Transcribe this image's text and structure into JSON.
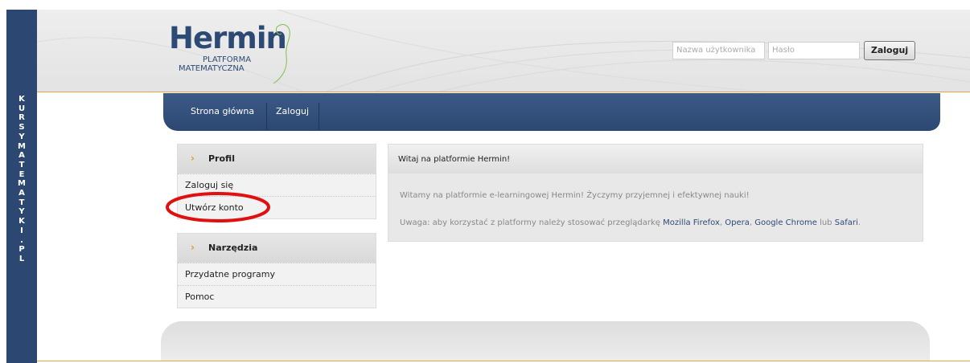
{
  "side_strip": {
    "letters": [
      "K",
      "U",
      "R",
      "S",
      "Y",
      "M",
      "A",
      "T",
      "E",
      "M",
      "A",
      "T",
      "Y",
      "K",
      "I",
      ".",
      "P",
      "L"
    ]
  },
  "logo": {
    "name": "Hermin",
    "line1": "PLATFORMA",
    "line2": "MATEMATYCZNA"
  },
  "login": {
    "username_placeholder": "Nazwa użytkownika",
    "password_placeholder": "Hasło",
    "button_label": "Zaloguj"
  },
  "nav": {
    "items": [
      "Strona główna",
      "Zaloguj"
    ]
  },
  "profil_box": {
    "title": "Profil",
    "links": [
      "Zaloguj się",
      "Utwórz konto"
    ]
  },
  "narzedzia_box": {
    "title": "Narzędzia",
    "links": [
      "Przydatne programy",
      "Pomoc"
    ]
  },
  "welcome": {
    "title": "Witaj na platformie Hermin!",
    "line1": "Witamy na platformie e-learningowej Hermin! Życzymy przyjemnej i efektywnej nauki!",
    "line2_prefix": "Uwaga: aby korzystać z platformy należy stosować przeglądarkę ",
    "browsers": [
      "Mozilla Firefox",
      "Opera",
      "Google Chrome",
      "Safari"
    ],
    "sep1": ", ",
    "sep_last": " lub ",
    "end": "."
  },
  "colors": {
    "navy": "#2c4872",
    "orange_accent": "#e39a1e",
    "highlight_red": "#e01010"
  },
  "icons": {
    "arrow": "chevron-right-icon",
    "logo_animal": "ferret-icon"
  }
}
